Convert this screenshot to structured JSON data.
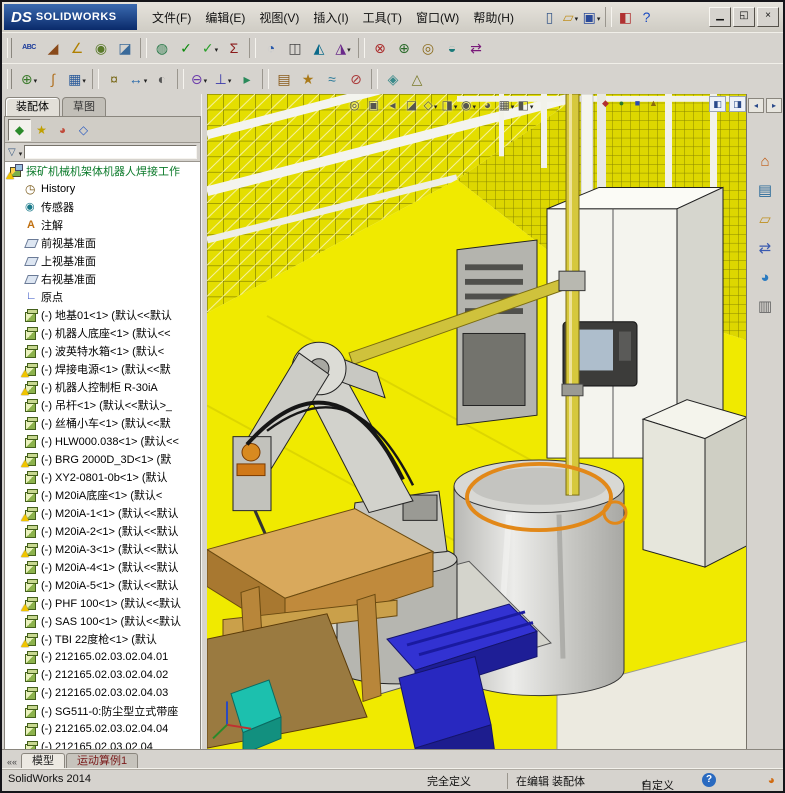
{
  "window": {
    "logo_ds": "DS",
    "logo_text": "SOLIDWORKS",
    "controls": [
      {
        "name": "minimize-button",
        "glyph": "▁"
      },
      {
        "name": "restore-button",
        "glyph": "◱"
      },
      {
        "name": "close-button",
        "glyph": "×"
      }
    ]
  },
  "menus": [
    {
      "label": "文件(F)"
    },
    {
      "label": "编辑(E)"
    },
    {
      "label": "视图(V)"
    },
    {
      "label": "插入(I)"
    },
    {
      "label": "工具(T)"
    },
    {
      "label": "窗口(W)"
    },
    {
      "label": "帮助(H)"
    }
  ],
  "toolbars": {
    "title": [
      {
        "name": "new-document-icon",
        "glyph": "▯",
        "color": "#3a5a8a"
      },
      {
        "name": "open-icon",
        "glyph": "▱",
        "color": "#c09020",
        "caret": true
      },
      {
        "name": "save-icon",
        "glyph": "▣",
        "color": "#2a4a9a",
        "caret": true
      },
      {
        "sep": true
      },
      {
        "name": "rebuild-icon",
        "glyph": "◧",
        "color": "#b03030"
      },
      {
        "name": "help-icon",
        "glyph": "?",
        "color": "#1a4ac0"
      }
    ],
    "row2": [
      {
        "name": "spell-check-icon",
        "glyph": "ABC",
        "color": "#1a3a9a",
        "small": true
      },
      {
        "name": "eyedropper-icon",
        "glyph": "◢",
        "color": "#8a4a1a"
      },
      {
        "name": "measure-icon",
        "glyph": "∠",
        "color": "#b08000"
      },
      {
        "name": "mass-properties-icon",
        "glyph": "◉",
        "color": "#5a7a2a"
      },
      {
        "name": "section-properties-icon",
        "glyph": "◪",
        "color": "#3a6a9a"
      },
      {
        "sep": true
      },
      {
        "name": "sensor-icon",
        "glyph": "◍",
        "color": "#2a7a4a"
      },
      {
        "name": "check-document-icon",
        "glyph": "✓",
        "color": "#0a8a0a"
      },
      {
        "name": "design-checker-icon",
        "glyph": "✓",
        "color": "#2aa02a",
        "caret": true
      },
      {
        "name": "equations-icon",
        "glyph": "Σ",
        "color": "#8a1a1a"
      },
      {
        "sep": true
      },
      {
        "name": "curvature-icon",
        "glyph": "◔",
        "color": "#2a5aaa"
      },
      {
        "name": "zebra-stripes-icon",
        "glyph": "◫",
        "color": "#444444"
      },
      {
        "name": "draft-analysis-icon",
        "glyph": "◭",
        "color": "#0a6a8a"
      },
      {
        "name": "undercut-analysis-icon",
        "glyph": "◮",
        "color": "#6a2a8a",
        "caret": true
      },
      {
        "sep": true
      },
      {
        "name": "interference-detection-icon",
        "glyph": "⊗",
        "color": "#aa2a2a"
      },
      {
        "name": "clearance-verification-icon",
        "glyph": "⊕",
        "color": "#2a6a2a"
      },
      {
        "name": "hole-alignment-icon",
        "glyph": "◎",
        "color": "#8a6a1a"
      },
      {
        "name": "performance-evaluation-icon",
        "glyph": "◒",
        "color": "#1a7a7a"
      },
      {
        "name": "compare-icon",
        "glyph": "⇄",
        "color": "#7a1a7a"
      }
    ],
    "row3": [
      {
        "name": "insert-component-icon",
        "glyph": "⊕",
        "color": "#3a7a2a",
        "caret": true
      },
      {
        "name": "mate-icon",
        "glyph": "∫",
        "color": "#b07020"
      },
      {
        "name": "linear-pattern-icon",
        "glyph": "▦",
        "color": "#2a5a9a",
        "caret": true
      },
      {
        "sep": true
      },
      {
        "name": "smart-fasteners-icon",
        "glyph": "¤",
        "color": "#7a6a1a"
      },
      {
        "name": "move-component-icon",
        "glyph": "↔",
        "color": "#2a6aaa",
        "caret": true
      },
      {
        "name": "show-hidden-icon",
        "glyph": "◐",
        "color": "#555555"
      },
      {
        "sep": true
      },
      {
        "name": "assembly-features-icon",
        "glyph": "⊖",
        "color": "#6a3aaa",
        "caret": true
      },
      {
        "name": "reference-geometry-icon",
        "glyph": "⊥",
        "color": "#3a3aaa",
        "caret": true
      },
      {
        "name": "motion-study-icon",
        "glyph": "▸",
        "color": "#2a8a5a"
      },
      {
        "sep": true
      },
      {
        "name": "bill-of-materials-icon",
        "glyph": "▤",
        "color": "#8a5a1a"
      },
      {
        "name": "exploded-view-icon",
        "glyph": "★",
        "color": "#aa7a1a"
      },
      {
        "name": "explode-lines-icon",
        "glyph": "≈",
        "color": "#2a7a9a"
      },
      {
        "name": "interference-icon",
        "glyph": "⊘",
        "color": "#aa3a3a"
      },
      {
        "sep": true
      },
      {
        "name": "large-design-review-icon",
        "glyph": "◈",
        "color": "#3a8a8a"
      },
      {
        "name": "instant3d-icon",
        "glyph": "△",
        "color": "#7a7a2a"
      }
    ]
  },
  "left_panel": {
    "tabs": {
      "assembly": "装配体",
      "sketch": "草图"
    },
    "manager_tabs": [
      {
        "name": "featuremanager-tab",
        "glyph": "◆",
        "color": "#2a8a2a",
        "active": true
      },
      {
        "name": "propertymanager-tab",
        "glyph": "★",
        "color": "#c0a000"
      },
      {
        "name": "configurationmanager-tab",
        "glyph": "◕",
        "color": "#c04a3a"
      },
      {
        "name": "dimxpert-tab",
        "glyph": "◇",
        "color": "#2a5ac0"
      }
    ],
    "more_chevron": "»",
    "filter": {
      "funnel_glyph": "▽"
    }
  },
  "tree": {
    "items": [
      {
        "label": "探矿机械机架体机器人焊接工作",
        "icon": "assembly",
        "warn": true,
        "indent": 0,
        "labelColor": "#0b7a2a"
      },
      {
        "label": "History",
        "icon": "history",
        "indent": 1
      },
      {
        "label": "传感器",
        "icon": "sensor",
        "indent": 1
      },
      {
        "label": "注解",
        "icon": "annotations",
        "indent": 1
      },
      {
        "label": "前视基准面",
        "icon": "plane",
        "indent": 1
      },
      {
        "label": "上视基准面",
        "icon": "plane",
        "indent": 1
      },
      {
        "label": "右视基准面",
        "icon": "plane",
        "indent": 1
      },
      {
        "label": "原点",
        "icon": "origin",
        "indent": 1
      },
      {
        "label": "(-) 地基01<1> (默认<<默认",
        "icon": "component",
        "indent": 1
      },
      {
        "label": "(-) 机器人底座<1> (默认<<",
        "icon": "component",
        "indent": 1
      },
      {
        "label": "(-) 波英特水箱<1> (默认<",
        "icon": "component",
        "indent": 1
      },
      {
        "label": "(-) 焊接电源<1> (默认<<默",
        "icon": "component",
        "warn": true,
        "indent": 1
      },
      {
        "label": "(-) 机器人控制柜 R-30iA",
        "icon": "component",
        "warn": true,
        "indent": 1
      },
      {
        "label": "(-) 吊杆<1> (默认<<默认>_",
        "icon": "component",
        "indent": 1
      },
      {
        "label": "(-) 丝桶小车<1> (默认<<默",
        "icon": "component",
        "indent": 1
      },
      {
        "label": "(-) HLW000.038<1> (默认<<",
        "icon": "component",
        "indent": 1
      },
      {
        "label": "(-) BRG 2000D_3D<1> (默",
        "icon": "component",
        "warn": true,
        "indent": 1
      },
      {
        "label": "(-) XY2-0801-0b<1> (默认",
        "icon": "component",
        "indent": 1
      },
      {
        "label": "(-) M20iA底座<1> (默认<",
        "icon": "component",
        "indent": 1
      },
      {
        "label": "(-) M20iA-1<1> (默认<<默认",
        "icon": "component",
        "warn": true,
        "indent": 1
      },
      {
        "label": "(-) M20iA-2<1> (默认<<默认",
        "icon": "component",
        "indent": 1
      },
      {
        "label": "(-) M20iA-3<1> (默认<<默认",
        "icon": "component",
        "warn": true,
        "indent": 1
      },
      {
        "label": "(-) M20iA-4<1> (默认<<默认",
        "icon": "component",
        "indent": 1
      },
      {
        "label": "(-) M20iA-5<1> (默认<<默认",
        "icon": "component",
        "indent": 1
      },
      {
        "label": "(-) PHF 100<1> (默认<<默认",
        "icon": "component",
        "warn": true,
        "indent": 1
      },
      {
        "label": "(-) SAS 100<1> (默认<<默认",
        "icon": "component",
        "indent": 1
      },
      {
        "label": "(-) TBI 22度枪<1> (默认",
        "icon": "component",
        "warn": true,
        "indent": 1
      },
      {
        "label": "(-) 212165.02.03.02.04.01",
        "icon": "component",
        "indent": 1
      },
      {
        "label": "(-) 212165.02.03.02.04.02",
        "icon": "component",
        "indent": 1
      },
      {
        "label": "(-) 212165.02.03.02.04.03",
        "icon": "component",
        "indent": 1
      },
      {
        "label": "(-) SG511-0:防尘型立式带座",
        "icon": "component",
        "indent": 1
      },
      {
        "label": "(-) 212165.02.03.02.04.04",
        "icon": "component",
        "indent": 1
      },
      {
        "label": "(-) 212165.02.03.02.04",
        "icon": "component",
        "indent": 1
      }
    ]
  },
  "viewport": {
    "hud": [
      {
        "name": "zoom-fit-icon",
        "glyph": "◎"
      },
      {
        "name": "zoom-area-icon",
        "glyph": "▣"
      },
      {
        "name": "previous-view-icon",
        "glyph": "◂"
      },
      {
        "name": "section-view-icon",
        "glyph": "◪"
      },
      {
        "name": "view-orientation-icon",
        "glyph": "◇",
        "caret": true
      },
      {
        "name": "display-style-icon",
        "glyph": "◨",
        "caret": true
      },
      {
        "name": "hide-show-items-icon",
        "glyph": "◉",
        "caret": true
      },
      {
        "name": "edit-appearance-icon",
        "glyph": "◕"
      },
      {
        "name": "apply-scene-icon",
        "glyph": "▦",
        "caret": true
      },
      {
        "name": "view-settings-icon",
        "glyph": "◧",
        "caret": true
      }
    ],
    "quick": [
      {
        "name": "quick-snaps-icon",
        "glyph": "◆",
        "color": "#b03030"
      },
      {
        "name": "quick-grid-icon",
        "glyph": "●",
        "color": "#2a7a2a"
      },
      {
        "name": "quick-views-icon",
        "glyph": "■",
        "color": "#2a4ab0"
      },
      {
        "name": "quick-settings-icon",
        "glyph": "▲",
        "color": "#8a6a10"
      }
    ],
    "panel_toggles": [
      {
        "name": "toggle-featuremanager-icon",
        "glyph": "◧"
      },
      {
        "name": "toggle-taskpane-icon",
        "glyph": "◨"
      }
    ],
    "colors": {
      "floor": "#f0ea00",
      "selection_ring": "#e28818",
      "pallet_blue": "#2a2ac8",
      "selected_teal": "#1cc0ae"
    }
  },
  "taskpane": {
    "top": [
      {
        "name": "taskpane-pin-icon",
        "glyph": "◂"
      },
      {
        "name": "taskpane-collapse-icon",
        "glyph": "▸"
      }
    ],
    "tabs": [
      {
        "name": "solidworks-resources-icon",
        "glyph": "⌂",
        "color": "#c05a10"
      },
      {
        "name": "design-library-icon",
        "glyph": "▤",
        "color": "#2a6a9a"
      },
      {
        "name": "file-explorer-icon",
        "glyph": "▱",
        "color": "#c09020"
      },
      {
        "name": "view-palette-icon",
        "glyph": "⇄",
        "color": "#3a5ab0"
      },
      {
        "name": "appearances-icon",
        "glyph": "◕",
        "color": "#2a7ac0"
      },
      {
        "name": "custom-properties-icon",
        "glyph": "▥",
        "color": "#666666"
      }
    ]
  },
  "bottom_tabs": {
    "nav_glyph": "««",
    "model": "模型",
    "motion": "运动算例1"
  },
  "status": {
    "app": "SolidWorks 2014",
    "defined": "完全定义",
    "editing": "在编辑 装配体",
    "custom": "自定义",
    "custom_caret": "▾",
    "help_glyph": "?",
    "sw_glyph": "◕"
  }
}
